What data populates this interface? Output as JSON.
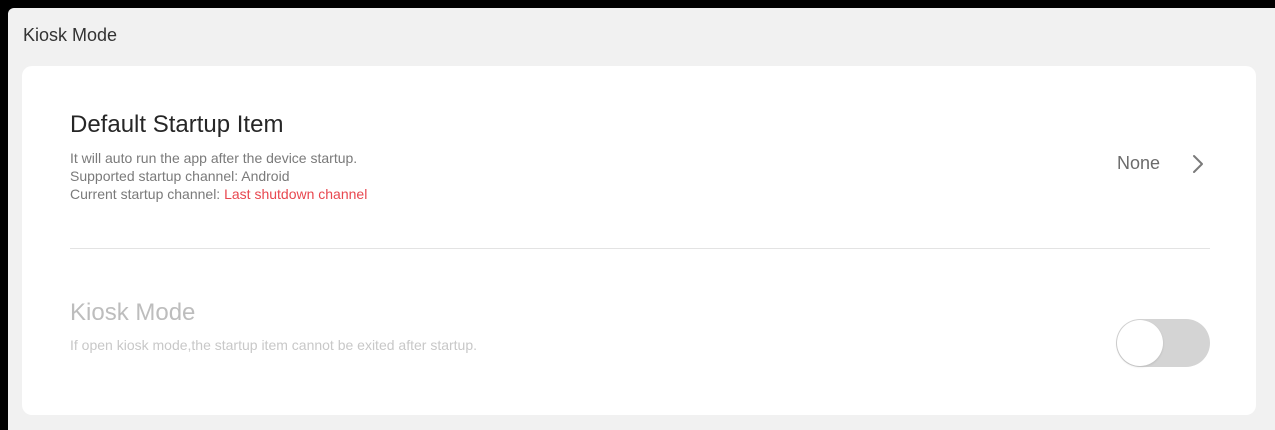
{
  "header": {
    "title": "Kiosk Mode"
  },
  "startup": {
    "title": "Default Startup Item",
    "desc_line1": "It will auto run the app after the device startup.",
    "desc_line2": "Supported startup channel: Android",
    "desc_line3_prefix": "Current startup channel: ",
    "desc_line3_value": "Last shutdown channel",
    "value": "None",
    "icon": "chevron-right-icon"
  },
  "kiosk": {
    "title": "Kiosk Mode",
    "desc": "If open kiosk mode,the startup item cannot be exited after startup.",
    "toggle_state": "off",
    "disabled": true
  },
  "colors": {
    "highlight": "#e8474f",
    "disabled_text": "#bdbdbd",
    "toggle_track": "#d4d4d4"
  }
}
